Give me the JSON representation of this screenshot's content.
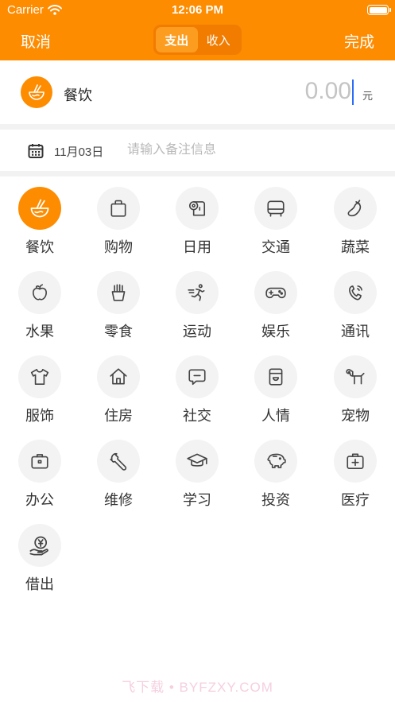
{
  "status_bar": {
    "carrier": "Carrier",
    "time": "12:06 PM"
  },
  "nav": {
    "cancel": "取消",
    "done": "完成",
    "segments": [
      {
        "label": "支出",
        "active": true
      },
      {
        "label": "收入",
        "active": false
      }
    ]
  },
  "entry": {
    "category": "餐饮",
    "category_icon": "noodle-bowl-icon",
    "amount_placeholder": "0.00",
    "unit": "元"
  },
  "note": {
    "date": "11月03日",
    "placeholder": "请输入备注信息",
    "value": ""
  },
  "categories": [
    {
      "label": "餐饮",
      "icon": "noodle-bowl-icon",
      "selected": true
    },
    {
      "label": "购物",
      "icon": "shopping-bag-icon",
      "selected": false
    },
    {
      "label": "日用",
      "icon": "toilet-paper-icon",
      "selected": false
    },
    {
      "label": "交通",
      "icon": "bus-icon",
      "selected": false
    },
    {
      "label": "蔬菜",
      "icon": "eggplant-icon",
      "selected": false
    },
    {
      "label": "水果",
      "icon": "apple-icon",
      "selected": false
    },
    {
      "label": "零食",
      "icon": "fries-icon",
      "selected": false
    },
    {
      "label": "运动",
      "icon": "runner-icon",
      "selected": false
    },
    {
      "label": "娱乐",
      "icon": "gamepad-icon",
      "selected": false
    },
    {
      "label": "通讯",
      "icon": "phone-icon",
      "selected": false
    },
    {
      "label": "服饰",
      "icon": "tshirt-icon",
      "selected": false
    },
    {
      "label": "住房",
      "icon": "house-icon",
      "selected": false
    },
    {
      "label": "社交",
      "icon": "chat-bubble-icon",
      "selected": false
    },
    {
      "label": "人情",
      "icon": "gift-box-icon",
      "selected": false
    },
    {
      "label": "宠物",
      "icon": "dog-icon",
      "selected": false
    },
    {
      "label": "办公",
      "icon": "briefcase-icon",
      "selected": false
    },
    {
      "label": "维修",
      "icon": "wrench-icon",
      "selected": false
    },
    {
      "label": "学习",
      "icon": "graduation-cap-icon",
      "selected": false
    },
    {
      "label": "投资",
      "icon": "piggy-bank-icon",
      "selected": false
    },
    {
      "label": "医疗",
      "icon": "medical-kit-icon",
      "selected": false
    },
    {
      "label": "借出",
      "icon": "yen-hand-icon",
      "selected": false
    }
  ],
  "colors": {
    "brand": "#fd8c01",
    "icon_bg": "#f3f3f3",
    "icon_stroke": "#444444"
  },
  "watermark": "飞下载 • BYFZXY.COM"
}
